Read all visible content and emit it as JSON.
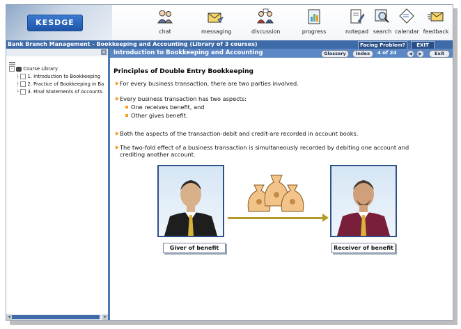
{
  "logo": "KESDGE",
  "tools": [
    {
      "label": "chat",
      "icon": "chat-icon"
    },
    {
      "label": "messaging",
      "icon": "messaging-icon"
    },
    {
      "label": "discussion",
      "icon": "discussion-icon"
    },
    {
      "label": "progress",
      "icon": "progress-icon"
    },
    {
      "label": "notepad",
      "icon": "notepad-icon"
    },
    {
      "label": "search",
      "icon": "search-icon"
    },
    {
      "label": "calendar",
      "icon": "calendar-icon"
    },
    {
      "label": "feedback",
      "icon": "feedback-icon"
    }
  ],
  "titlebar": {
    "title": "Bank Branch Management - Bookkeeping and Accounting (Library of 3 courses)",
    "facing_problem": "Facing Problem?",
    "exit": "EXIT"
  },
  "tree": {
    "root": "Course Library",
    "items": [
      "1. Introduction to Bookkeeping",
      "2. Practice of Bookkeeping in Ba",
      "3. Final Statements of Accounts"
    ]
  },
  "content_header": {
    "title": "Introduction to Bookkeeping and Accounting",
    "glossary": "Glossary",
    "index": "Index",
    "page_indicator": "4 of 24",
    "exit": "Exit"
  },
  "content": {
    "heading": "Principles of Double Entry Bookkeeping",
    "bullets": [
      "For every business transaction, there are two parties involved.",
      "Every business transaction has two aspects:",
      "Both the aspects of the transaction-debit and credit-are recorded in account books.",
      "The two-fold effect of a business transaction is simultaneously recorded by debiting one account and",
      "crediting another account."
    ],
    "sub_bullets": [
      "One receives benefit, and",
      "Other gives benefit."
    ],
    "giver_caption": "Giver of benefit",
    "receiver_caption": "Receiver of benefit"
  },
  "colors": {
    "accent_blue": "#3e6aa8",
    "header_blue": "#5b87c4",
    "bullet_orange": "#f2a020"
  }
}
